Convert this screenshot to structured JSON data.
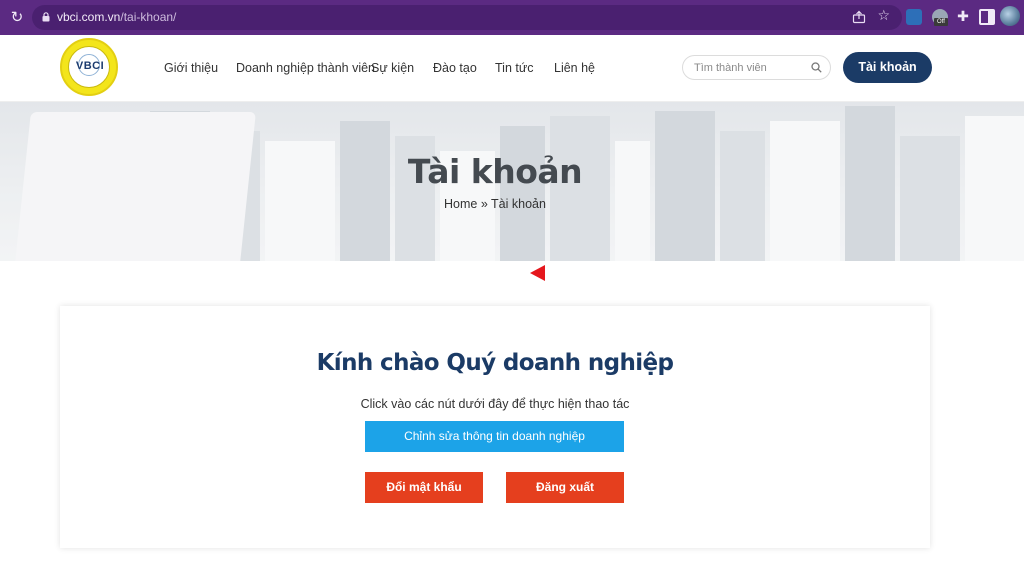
{
  "browser": {
    "url_host": "vbci.com.vn",
    "url_path": "/tai-khoan/",
    "extension_badge": "Off",
    "icons": [
      "reload-icon",
      "lock-icon",
      "share-icon",
      "star-icon",
      "extension-icon",
      "puzzle-icon",
      "side-panel-icon",
      "profile-avatar"
    ]
  },
  "header": {
    "logo_text": "VBCI",
    "nav": [
      {
        "label": "Giới thiệu"
      },
      {
        "label": "Doanh nghiệp thành viên"
      },
      {
        "label": "Sự kiện"
      },
      {
        "label": "Đào tạo"
      },
      {
        "label": "Tin tức"
      },
      {
        "label": "Liên hệ"
      }
    ],
    "search_placeholder": "Tìm thành viên",
    "account_button": "Tài khoản"
  },
  "hero": {
    "title": "Tài khoản",
    "breadcrumb": "Home » Tài khoản"
  },
  "card": {
    "title": "Kính chào Quý doanh nghiệp",
    "subtitle": "Click vào các nút dưới đây để thực hiện thao tác",
    "edit_button": "Chỉnh sửa thông tin doanh nghiệp",
    "password_button": "Đổi mật khẩu",
    "logout_button": "Đăng xuất"
  },
  "colors": {
    "browser_bar": "#5b2a82",
    "brand_navy": "#1b3b66",
    "edit_blue": "#1ca3e8",
    "action_red": "#e53f1e",
    "annotation_red": "#e5171d"
  }
}
